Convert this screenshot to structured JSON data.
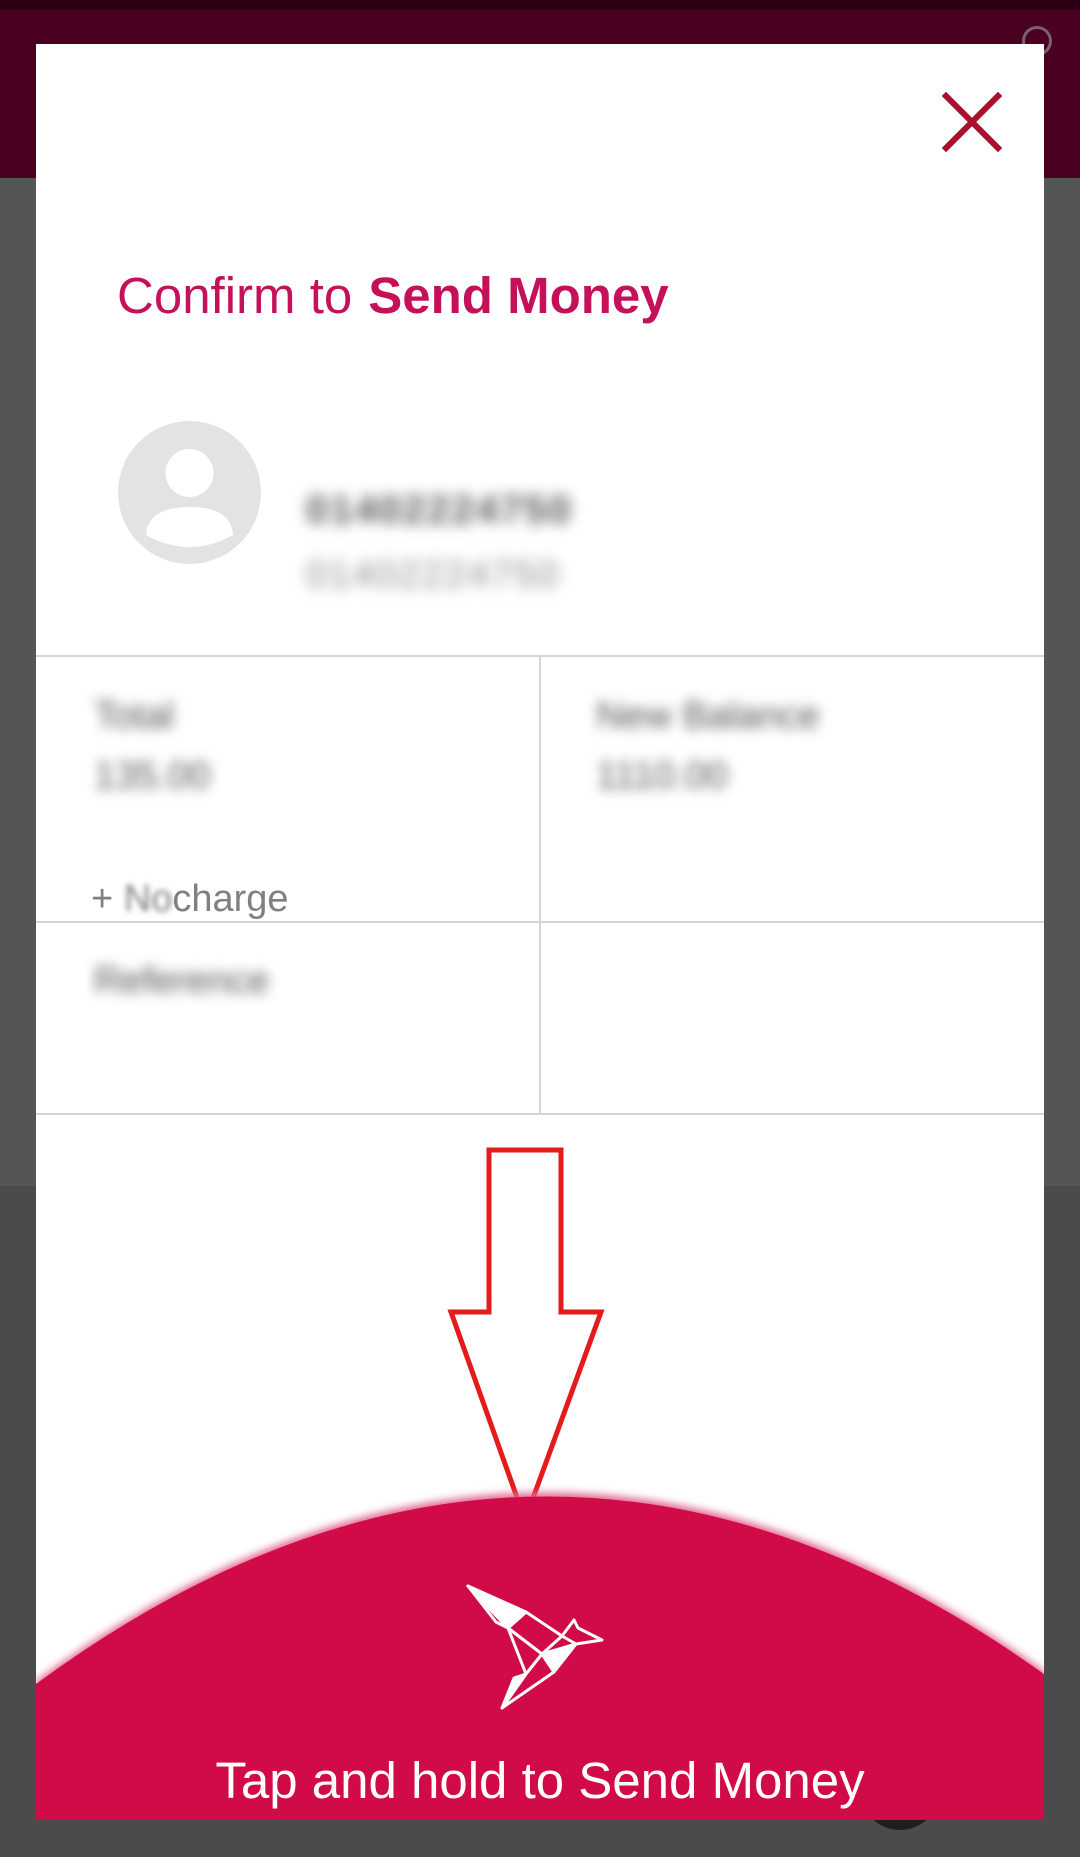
{
  "modal": {
    "title_prefix": "Confirm to",
    "title_action": "Send Money",
    "close_icon": "close-icon"
  },
  "recipient": {
    "name": "01402224750",
    "number": "01402224750",
    "avatar_icon": "person-icon"
  },
  "summary": {
    "total_label": "Total",
    "total_value": "135.00",
    "charge_text_prefix": "+",
    "charge_text_blurred": "No",
    "charge_text_suffix": "charge",
    "new_balance_label": "New Balance",
    "new_balance_value": "1110.00",
    "reference_label": "Reference"
  },
  "action": {
    "send_label": "Tap and hold to Send Money",
    "icon": "origami-bird-icon"
  },
  "colors": {
    "brand": "#c4115a",
    "button": "#d10a48",
    "close": "#a8102c",
    "annotation": "#e31b1b",
    "header": "#4a0020"
  }
}
